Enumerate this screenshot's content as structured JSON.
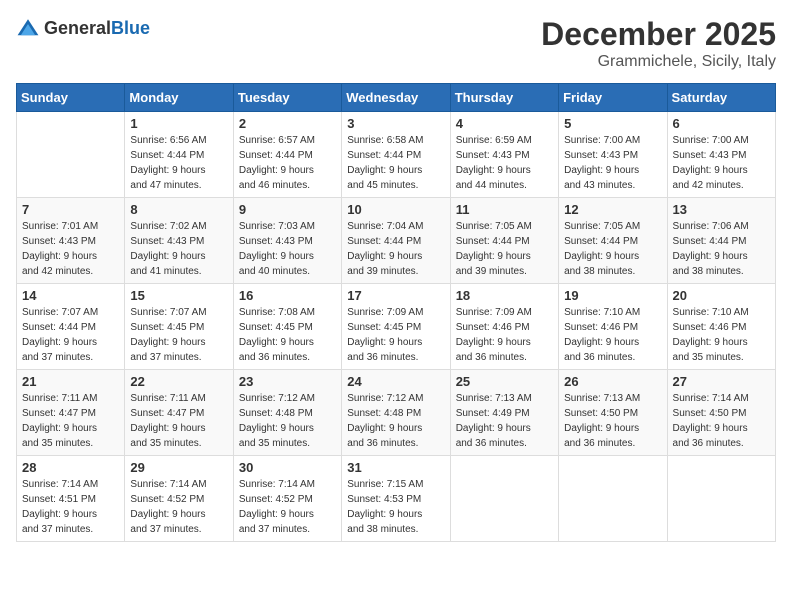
{
  "logo": {
    "general": "General",
    "blue": "Blue"
  },
  "header": {
    "month": "December 2025",
    "location": "Grammichele, Sicily, Italy"
  },
  "days_of_week": [
    "Sunday",
    "Monday",
    "Tuesday",
    "Wednesday",
    "Thursday",
    "Friday",
    "Saturday"
  ],
  "weeks": [
    [
      {
        "day": "",
        "info": ""
      },
      {
        "day": "1",
        "info": "Sunrise: 6:56 AM\nSunset: 4:44 PM\nDaylight: 9 hours\nand 47 minutes."
      },
      {
        "day": "2",
        "info": "Sunrise: 6:57 AM\nSunset: 4:44 PM\nDaylight: 9 hours\nand 46 minutes."
      },
      {
        "day": "3",
        "info": "Sunrise: 6:58 AM\nSunset: 4:44 PM\nDaylight: 9 hours\nand 45 minutes."
      },
      {
        "day": "4",
        "info": "Sunrise: 6:59 AM\nSunset: 4:43 PM\nDaylight: 9 hours\nand 44 minutes."
      },
      {
        "day": "5",
        "info": "Sunrise: 7:00 AM\nSunset: 4:43 PM\nDaylight: 9 hours\nand 43 minutes."
      },
      {
        "day": "6",
        "info": "Sunrise: 7:00 AM\nSunset: 4:43 PM\nDaylight: 9 hours\nand 42 minutes."
      }
    ],
    [
      {
        "day": "7",
        "info": "Sunrise: 7:01 AM\nSunset: 4:43 PM\nDaylight: 9 hours\nand 42 minutes."
      },
      {
        "day": "8",
        "info": "Sunrise: 7:02 AM\nSunset: 4:43 PM\nDaylight: 9 hours\nand 41 minutes."
      },
      {
        "day": "9",
        "info": "Sunrise: 7:03 AM\nSunset: 4:43 PM\nDaylight: 9 hours\nand 40 minutes."
      },
      {
        "day": "10",
        "info": "Sunrise: 7:04 AM\nSunset: 4:44 PM\nDaylight: 9 hours\nand 39 minutes."
      },
      {
        "day": "11",
        "info": "Sunrise: 7:05 AM\nSunset: 4:44 PM\nDaylight: 9 hours\nand 39 minutes."
      },
      {
        "day": "12",
        "info": "Sunrise: 7:05 AM\nSunset: 4:44 PM\nDaylight: 9 hours\nand 38 minutes."
      },
      {
        "day": "13",
        "info": "Sunrise: 7:06 AM\nSunset: 4:44 PM\nDaylight: 9 hours\nand 38 minutes."
      }
    ],
    [
      {
        "day": "14",
        "info": "Sunrise: 7:07 AM\nSunset: 4:44 PM\nDaylight: 9 hours\nand 37 minutes."
      },
      {
        "day": "15",
        "info": "Sunrise: 7:07 AM\nSunset: 4:45 PM\nDaylight: 9 hours\nand 37 minutes."
      },
      {
        "day": "16",
        "info": "Sunrise: 7:08 AM\nSunset: 4:45 PM\nDaylight: 9 hours\nand 36 minutes."
      },
      {
        "day": "17",
        "info": "Sunrise: 7:09 AM\nSunset: 4:45 PM\nDaylight: 9 hours\nand 36 minutes."
      },
      {
        "day": "18",
        "info": "Sunrise: 7:09 AM\nSunset: 4:46 PM\nDaylight: 9 hours\nand 36 minutes."
      },
      {
        "day": "19",
        "info": "Sunrise: 7:10 AM\nSunset: 4:46 PM\nDaylight: 9 hours\nand 36 minutes."
      },
      {
        "day": "20",
        "info": "Sunrise: 7:10 AM\nSunset: 4:46 PM\nDaylight: 9 hours\nand 35 minutes."
      }
    ],
    [
      {
        "day": "21",
        "info": "Sunrise: 7:11 AM\nSunset: 4:47 PM\nDaylight: 9 hours\nand 35 minutes."
      },
      {
        "day": "22",
        "info": "Sunrise: 7:11 AM\nSunset: 4:47 PM\nDaylight: 9 hours\nand 35 minutes."
      },
      {
        "day": "23",
        "info": "Sunrise: 7:12 AM\nSunset: 4:48 PM\nDaylight: 9 hours\nand 35 minutes."
      },
      {
        "day": "24",
        "info": "Sunrise: 7:12 AM\nSunset: 4:48 PM\nDaylight: 9 hours\nand 36 minutes."
      },
      {
        "day": "25",
        "info": "Sunrise: 7:13 AM\nSunset: 4:49 PM\nDaylight: 9 hours\nand 36 minutes."
      },
      {
        "day": "26",
        "info": "Sunrise: 7:13 AM\nSunset: 4:50 PM\nDaylight: 9 hours\nand 36 minutes."
      },
      {
        "day": "27",
        "info": "Sunrise: 7:14 AM\nSunset: 4:50 PM\nDaylight: 9 hours\nand 36 minutes."
      }
    ],
    [
      {
        "day": "28",
        "info": "Sunrise: 7:14 AM\nSunset: 4:51 PM\nDaylight: 9 hours\nand 37 minutes."
      },
      {
        "day": "29",
        "info": "Sunrise: 7:14 AM\nSunset: 4:52 PM\nDaylight: 9 hours\nand 37 minutes."
      },
      {
        "day": "30",
        "info": "Sunrise: 7:14 AM\nSunset: 4:52 PM\nDaylight: 9 hours\nand 37 minutes."
      },
      {
        "day": "31",
        "info": "Sunrise: 7:15 AM\nSunset: 4:53 PM\nDaylight: 9 hours\nand 38 minutes."
      },
      {
        "day": "",
        "info": ""
      },
      {
        "day": "",
        "info": ""
      },
      {
        "day": "",
        "info": ""
      }
    ]
  ]
}
